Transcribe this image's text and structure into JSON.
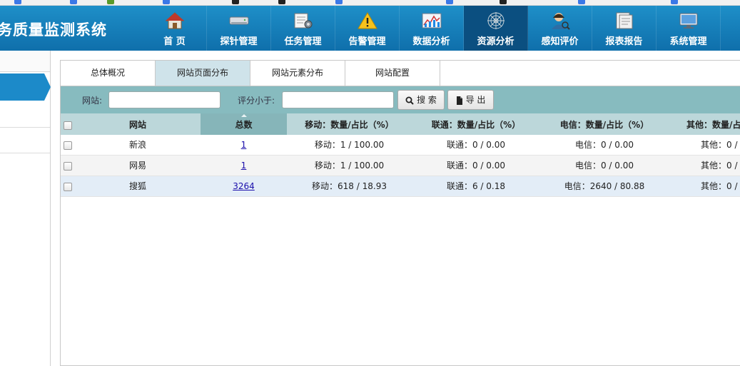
{
  "header": {
    "system_title": "务质量监测系统",
    "nav": [
      {
        "label": "首 页",
        "icon": "home-icon"
      },
      {
        "label": "探针管理",
        "icon": "probe-device-icon"
      },
      {
        "label": "任务管理",
        "icon": "task-settings-icon"
      },
      {
        "label": "告警管理",
        "icon": "warning-icon"
      },
      {
        "label": "数据分析",
        "icon": "chart-icon"
      },
      {
        "label": "资源分析",
        "icon": "web-icon",
        "active": true
      },
      {
        "label": "感知评价",
        "icon": "user-search-icon"
      },
      {
        "label": "报表报告",
        "icon": "report-icon"
      },
      {
        "label": "系统管理",
        "icon": "monitor-icon"
      }
    ]
  },
  "tabs": [
    {
      "label": "总体概况"
    },
    {
      "label": "网站页面分布",
      "active": true
    },
    {
      "label": "网站元素分布"
    },
    {
      "label": "网站配置"
    }
  ],
  "search": {
    "site_label": "网站:",
    "site_value": "",
    "score_label": "评分小于:",
    "score_value": "",
    "search_button": "搜 索",
    "export_button": "导 出"
  },
  "table": {
    "columns": [
      "网站",
      "总数",
      "移动：数量/占比（%）",
      "联通：数量/占比（%）",
      "电信：数量/占比（%）",
      "其他：数量/占"
    ],
    "rows": [
      {
        "site": "新浪",
        "total": "1",
        "mobile": "移动：1  /  100.00",
        "unicom": "联通：0  /  0.00",
        "telecom": "电信：0  /  0.00",
        "other": "其他：0  /"
      },
      {
        "site": "网易",
        "total": "1",
        "mobile": "移动：1  /  100.00",
        "unicom": "联通：0  /  0.00",
        "telecom": "电信：0  /  0.00",
        "other": "其他：0  /"
      },
      {
        "site": "搜狐",
        "total": "3264",
        "mobile": "移动：618  /  18.93",
        "unicom": "联通：6  /  0.18",
        "telecom": "电信：2640  /  80.88",
        "other": "其他：0  /"
      }
    ]
  },
  "colors": {
    "header": "#1580bd",
    "active_nav": "#0b4f80",
    "search_bar": "#87bbbf",
    "table_header": "#bcd7da",
    "sorted_column": "#86b5b9"
  }
}
